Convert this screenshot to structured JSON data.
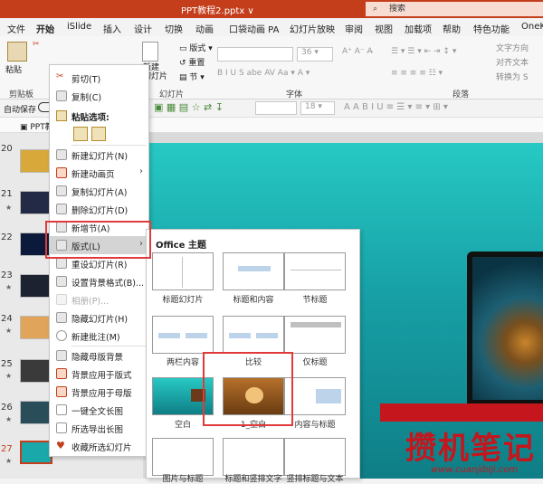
{
  "titlebar": {
    "title": "PPT教程2.pptx ∨",
    "search_placeholder": "搜索",
    "search_icon": "search-icon"
  },
  "tabs": [
    "文件",
    "开始",
    "iSlide",
    "插入",
    "设计",
    "切换",
    "动画",
    "口袋动画 PA",
    "幻灯片放映",
    "审阅",
    "视图",
    "加载项",
    "帮助",
    "特色功能",
    "OneK"
  ],
  "active_tab": "开始",
  "ribbon": {
    "groups": {
      "clipboard": "剪贴板",
      "slides": "幻灯片",
      "font": "字体",
      "paragraph": "段落"
    },
    "paste": "粘贴",
    "new_slide": "新建\n幻灯片",
    "reuse": "在线",
    "new2": "新加",
    "layout": "版式",
    "reset": "重置",
    "section": "节",
    "font_size": "36",
    "text_direction": "文字方向",
    "align_text": "对齐文本",
    "smartart": "转换为 S"
  },
  "qat": {
    "autosave": "自动保存",
    "font_size2": "18"
  },
  "doc_tab": "PPT教",
  "slides": [
    {
      "num": "20",
      "star": false,
      "color": "#d8a83a"
    },
    {
      "num": "21",
      "star": true,
      "color": "#222a45"
    },
    {
      "num": "22",
      "star": false,
      "color": "#0b1a3a"
    },
    {
      "num": "23",
      "star": true,
      "color": "#1c2230"
    },
    {
      "num": "24",
      "star": true,
      "color": "#e0a45a"
    },
    {
      "num": "25",
      "star": true,
      "color": "#3a3a3a"
    },
    {
      "num": "26",
      "star": true,
      "color": "#2a4d5a"
    },
    {
      "num": "27",
      "star": true,
      "color": "#1aa8aa"
    }
  ],
  "context_menu": {
    "cut": "剪切(T)",
    "copy": "复制(C)",
    "paste_options": "粘贴选项:",
    "items": [
      {
        "label": "新建幻灯片(N)",
        "arrow": false,
        "disabled": false
      },
      {
        "label": "新建动画页",
        "arrow": true,
        "disabled": false
      },
      {
        "label": "复制幻灯片(A)",
        "arrow": false,
        "disabled": false
      },
      {
        "label": "删除幻灯片(D)",
        "arrow": false,
        "disabled": false
      },
      {
        "label": "新增节(A)",
        "arrow": false,
        "disabled": false
      },
      {
        "label": "版式(L)",
        "arrow": true,
        "disabled": false,
        "highlighted": true
      },
      {
        "label": "重设幻灯片(R)",
        "arrow": false,
        "disabled": false
      },
      {
        "label": "设置背景格式(B)...",
        "arrow": false,
        "disabled": false
      },
      {
        "label": "相册(P)...",
        "arrow": false,
        "disabled": true
      },
      {
        "label": "隐藏幻灯片(H)",
        "arrow": false,
        "disabled": false
      },
      {
        "label": "新建批注(M)",
        "arrow": false,
        "disabled": false
      },
      {
        "label": "隐藏母版背景",
        "arrow": false,
        "disabled": false
      },
      {
        "label": "背景应用于版式",
        "arrow": false,
        "disabled": false
      },
      {
        "label": "背景应用于母版",
        "arrow": false,
        "disabled": false
      },
      {
        "label": "一键全文长图",
        "arrow": false,
        "disabled": false
      },
      {
        "label": "所选导出长图",
        "arrow": false,
        "disabled": false
      },
      {
        "label": "收藏所选幻灯片",
        "arrow": false,
        "disabled": false
      }
    ]
  },
  "layout_gallery": {
    "header": "Office 主题",
    "layouts": [
      {
        "name": "标题幻灯片"
      },
      {
        "name": "标题和内容"
      },
      {
        "name": "节标题"
      },
      {
        "name": "两栏内容"
      },
      {
        "name": "比较"
      },
      {
        "name": "仅标题"
      },
      {
        "name": "空白"
      },
      {
        "name": "1_空白",
        "selected": true
      },
      {
        "name": "内容与标题"
      },
      {
        "name": "图片与标题"
      },
      {
        "name": "标题和竖排文字"
      },
      {
        "name": "竖排标题与文本"
      }
    ]
  },
  "watermark": {
    "text": "攒机笔记",
    "url": "www.cuanjibiji.com"
  },
  "colors": {
    "accent": "#c43e1c",
    "highlight_box": "#e03a3a",
    "slide_bg": "#1aa8aa"
  }
}
